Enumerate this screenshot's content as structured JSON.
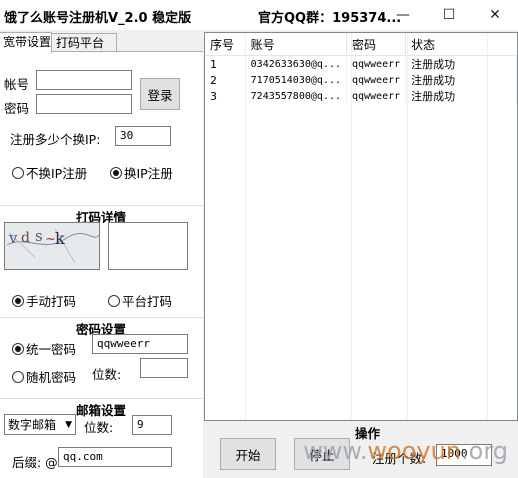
{
  "window": {
    "title": "饿了么账号注册机V_2.0 稳定版",
    "qq_group": "官方QQ群：195374...",
    "minimize_glyph": "—",
    "maximize_glyph": "☐",
    "close_glyph": "✕"
  },
  "tabs": [
    {
      "label": "宽带设置",
      "active": true
    },
    {
      "label": "打码平台",
      "active": false
    }
  ],
  "login": {
    "account_label": "帐号",
    "password_label": "密码",
    "account_value": "",
    "password_value": "",
    "login_button": "登录"
  },
  "ip": {
    "switch_label": "注册多少个换IP:",
    "switch_value": "30",
    "no_switch": "不换IP注册",
    "switch_ip": "换IP注册",
    "selected": "switch"
  },
  "captcha": {
    "section_title": "打码详情",
    "manual": "手动打码",
    "platform": "平台打码",
    "selected": "manual",
    "input_value": ""
  },
  "password_settings": {
    "section_title": "密码设置",
    "unified": "统一密码",
    "unified_value": "qqwweerr",
    "random": "随机密码",
    "digits_label": "位数:",
    "digits_value": "",
    "selected": "unified"
  },
  "email_settings": {
    "section_title": "邮箱设置",
    "type_value": "数字邮箱",
    "digits_label": "位数:",
    "digits_value": "9",
    "suffix_label": "后缀: @",
    "suffix_value": "qq.com"
  },
  "table": {
    "columns": [
      "序号",
      "账号",
      "密码",
      "状态"
    ],
    "rows": [
      {
        "no": "1",
        "account": "0342633630@q...",
        "password": "qqwweerr",
        "status": "注册成功"
      },
      {
        "no": "2",
        "account": "7170514030@q...",
        "password": "qqwweerr",
        "status": "注册成功"
      },
      {
        "no": "3",
        "account": "7243557800@q...",
        "password": "qqwweerr",
        "status": "注册成功"
      }
    ]
  },
  "operations": {
    "section_title": "操作",
    "start_button": "开始",
    "stop_button": "停止",
    "count_label": "注册个数:",
    "count_value": "1000"
  },
  "watermark": {
    "prefix": "www.",
    "brand": "wooyun",
    "suffix": ".org"
  }
}
